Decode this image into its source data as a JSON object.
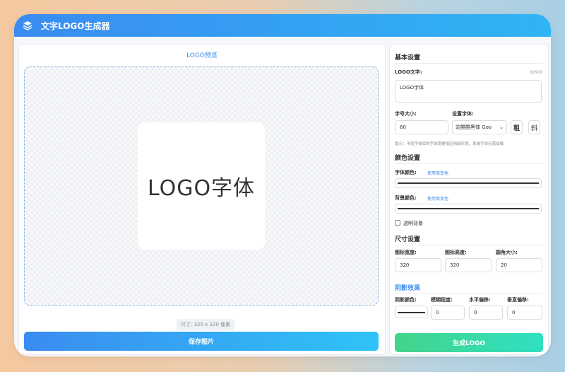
{
  "app": {
    "title": "文字LOGO生成器",
    "icon": "layers-icon"
  },
  "preview": {
    "title": "LOGO预览",
    "logo_text": "LOGO字体",
    "size_info": "尺寸: 320 x 320 像素",
    "save_label": "保存图片"
  },
  "settings": {
    "basic": {
      "title": "基本设置",
      "text_label": "LOGO文字:",
      "char_count": "6/600",
      "text_value": "LOGO字体",
      "font_size_label": "字号大小:",
      "font_size_value": "60",
      "font_label": "设置字体:",
      "font_value": "站酷酷黑体 Goo",
      "bold_label": "粗",
      "italic_label": "斜",
      "hint": "提示：不同字体库的字体需要相应网络环境，系统字体无需加载"
    },
    "color": {
      "title": "颜色设置",
      "font_color_label": "字体颜色:",
      "font_gradient_link": "使用渐变色",
      "font_color": "#333333",
      "bg_color_label": "背景颜色:",
      "bg_gradient_link": "使用渐变色",
      "bg_color": "#333333",
      "transparent_label": "透明背景",
      "transparent_checked": false
    },
    "size": {
      "title": "尺寸设置",
      "width_label": "图标宽度:",
      "width_value": "320",
      "height_label": "图标高度:",
      "height_value": "320",
      "radius_label": "圆角大小:",
      "radius_value": "20"
    },
    "shadow": {
      "title": "阴影效果",
      "color_label": "阴影颜色:",
      "color": "#333333",
      "blur_label": "模糊程度:",
      "blur_value": "0",
      "h_offset_label": "水平偏移:",
      "h_offset_value": "0",
      "v_offset_label": "垂直偏移:",
      "v_offset_value": "0"
    },
    "generate_label": "生成LOGO"
  },
  "colors": {
    "accent": "#3a8cf0",
    "generate_start": "#43d48a",
    "generate_end": "#2fe0c2"
  }
}
